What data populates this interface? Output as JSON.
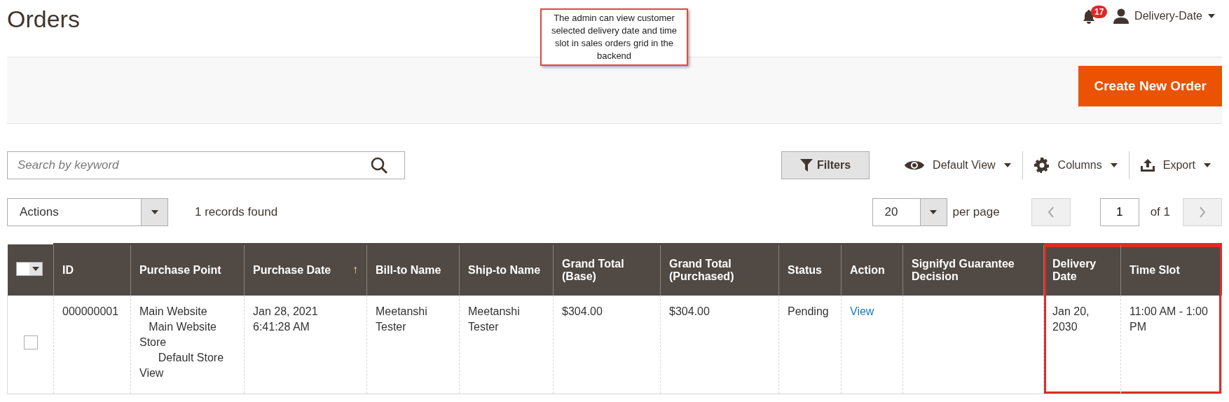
{
  "page_title": "Orders",
  "note": "The admin can view customer selected delivery date and time slot in sales orders grid in the backend",
  "header": {
    "notification_count": "17",
    "user": "Delivery-Date"
  },
  "create_button": "Create New Order",
  "search": {
    "placeholder": "Search by keyword"
  },
  "toolbar": {
    "filters": "Filters",
    "view": "Default View",
    "columns": "Columns",
    "export": "Export"
  },
  "actions": {
    "value": "Actions"
  },
  "records": "1 records found",
  "pager": {
    "per_page_value": "20",
    "per_page_label": "per page",
    "page": "1",
    "of": "of 1"
  },
  "table": {
    "columns": [
      {
        "label": "ID",
        "sorted": false,
        "highlighted": false
      },
      {
        "label": "Purchase Point",
        "sorted": false,
        "highlighted": false
      },
      {
        "label": "Purchase Date",
        "sorted": true,
        "highlighted": false
      },
      {
        "label": "Bill-to Name",
        "sorted": false,
        "highlighted": false
      },
      {
        "label": "Ship-to Name",
        "sorted": false,
        "highlighted": false
      },
      {
        "label": "Grand Total (Base)",
        "sorted": false,
        "highlighted": false
      },
      {
        "label": "Grand Total (Purchased)",
        "sorted": false,
        "highlighted": false
      },
      {
        "label": "Status",
        "sorted": false,
        "highlighted": false
      },
      {
        "label": "Action",
        "sorted": false,
        "highlighted": false,
        "kind": "link"
      },
      {
        "label": "Signifyd Guarantee Decision",
        "sorted": false,
        "highlighted": false
      },
      {
        "label": "Delivery Date",
        "sorted": false,
        "highlighted": true
      },
      {
        "label": "Time Slot",
        "sorted": false,
        "highlighted": true
      }
    ],
    "sort_mark": "↑",
    "all_checked": false,
    "rows": [
      {
        "checked": false,
        "cells": [
          "000000001",
          "Main Website\n   Main Website Store\n      Default Store View",
          "Jan 28, 2021 6:41:28 AM",
          "Meetanshi Tester",
          "Meetanshi Tester",
          "$304.00",
          "$304.00",
          "Pending",
          "View",
          "",
          "Jan 20, 2030",
          "11:00 AM - 1:00 PM"
        ]
      }
    ]
  }
}
